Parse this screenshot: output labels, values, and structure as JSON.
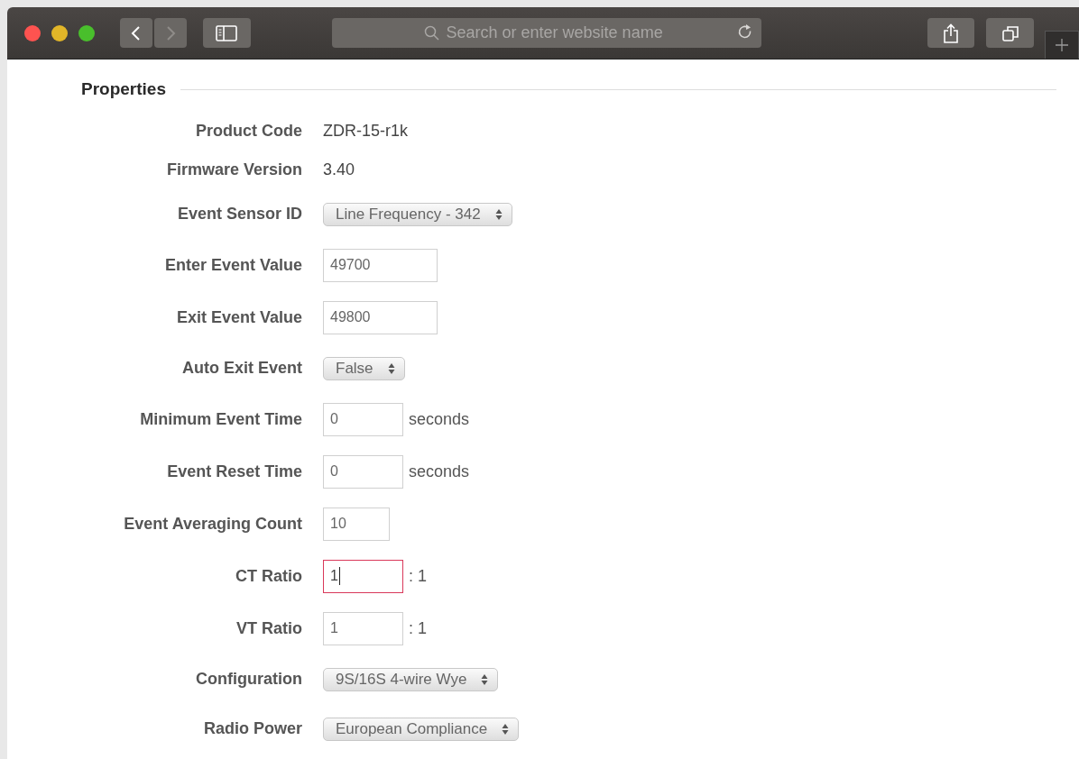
{
  "browser": {
    "search_placeholder": "Search or enter website name",
    "back_enabled": true,
    "forward_enabled": false
  },
  "section": {
    "title": "Properties"
  },
  "fields": [
    {
      "kind": "text",
      "label": "Product Code",
      "value": "ZDR-15-r1k"
    },
    {
      "kind": "text",
      "label": "Firmware Version",
      "value": "3.40"
    },
    {
      "kind": "select",
      "label": "Event Sensor ID",
      "value": "Line Frequency - 342"
    },
    {
      "kind": "input",
      "label": "Enter Event Value",
      "value": "49700",
      "focused": false
    },
    {
      "kind": "input",
      "label": "Exit Event Value",
      "value": "49800",
      "focused": false
    },
    {
      "kind": "select",
      "label": "Auto Exit Event",
      "value": "False"
    },
    {
      "kind": "input",
      "label": "Minimum Event Time",
      "value": "0",
      "suffix": "seconds",
      "focused": false
    },
    {
      "kind": "input",
      "label": "Event Reset Time",
      "value": "0",
      "suffix": "seconds",
      "focused": false
    },
    {
      "kind": "input",
      "label": "Event Averaging Count",
      "value": "10",
      "focused": false
    },
    {
      "kind": "input",
      "label": "CT Ratio",
      "value": "1",
      "suffix": ": 1",
      "focused": true
    },
    {
      "kind": "input",
      "label": "VT Ratio",
      "value": "1",
      "suffix": ": 1",
      "focused": false
    },
    {
      "kind": "select",
      "label": "Configuration",
      "value": "9S/16S 4-wire Wye"
    },
    {
      "kind": "select",
      "label": "Radio Power",
      "value": "European Compliance"
    }
  ]
}
